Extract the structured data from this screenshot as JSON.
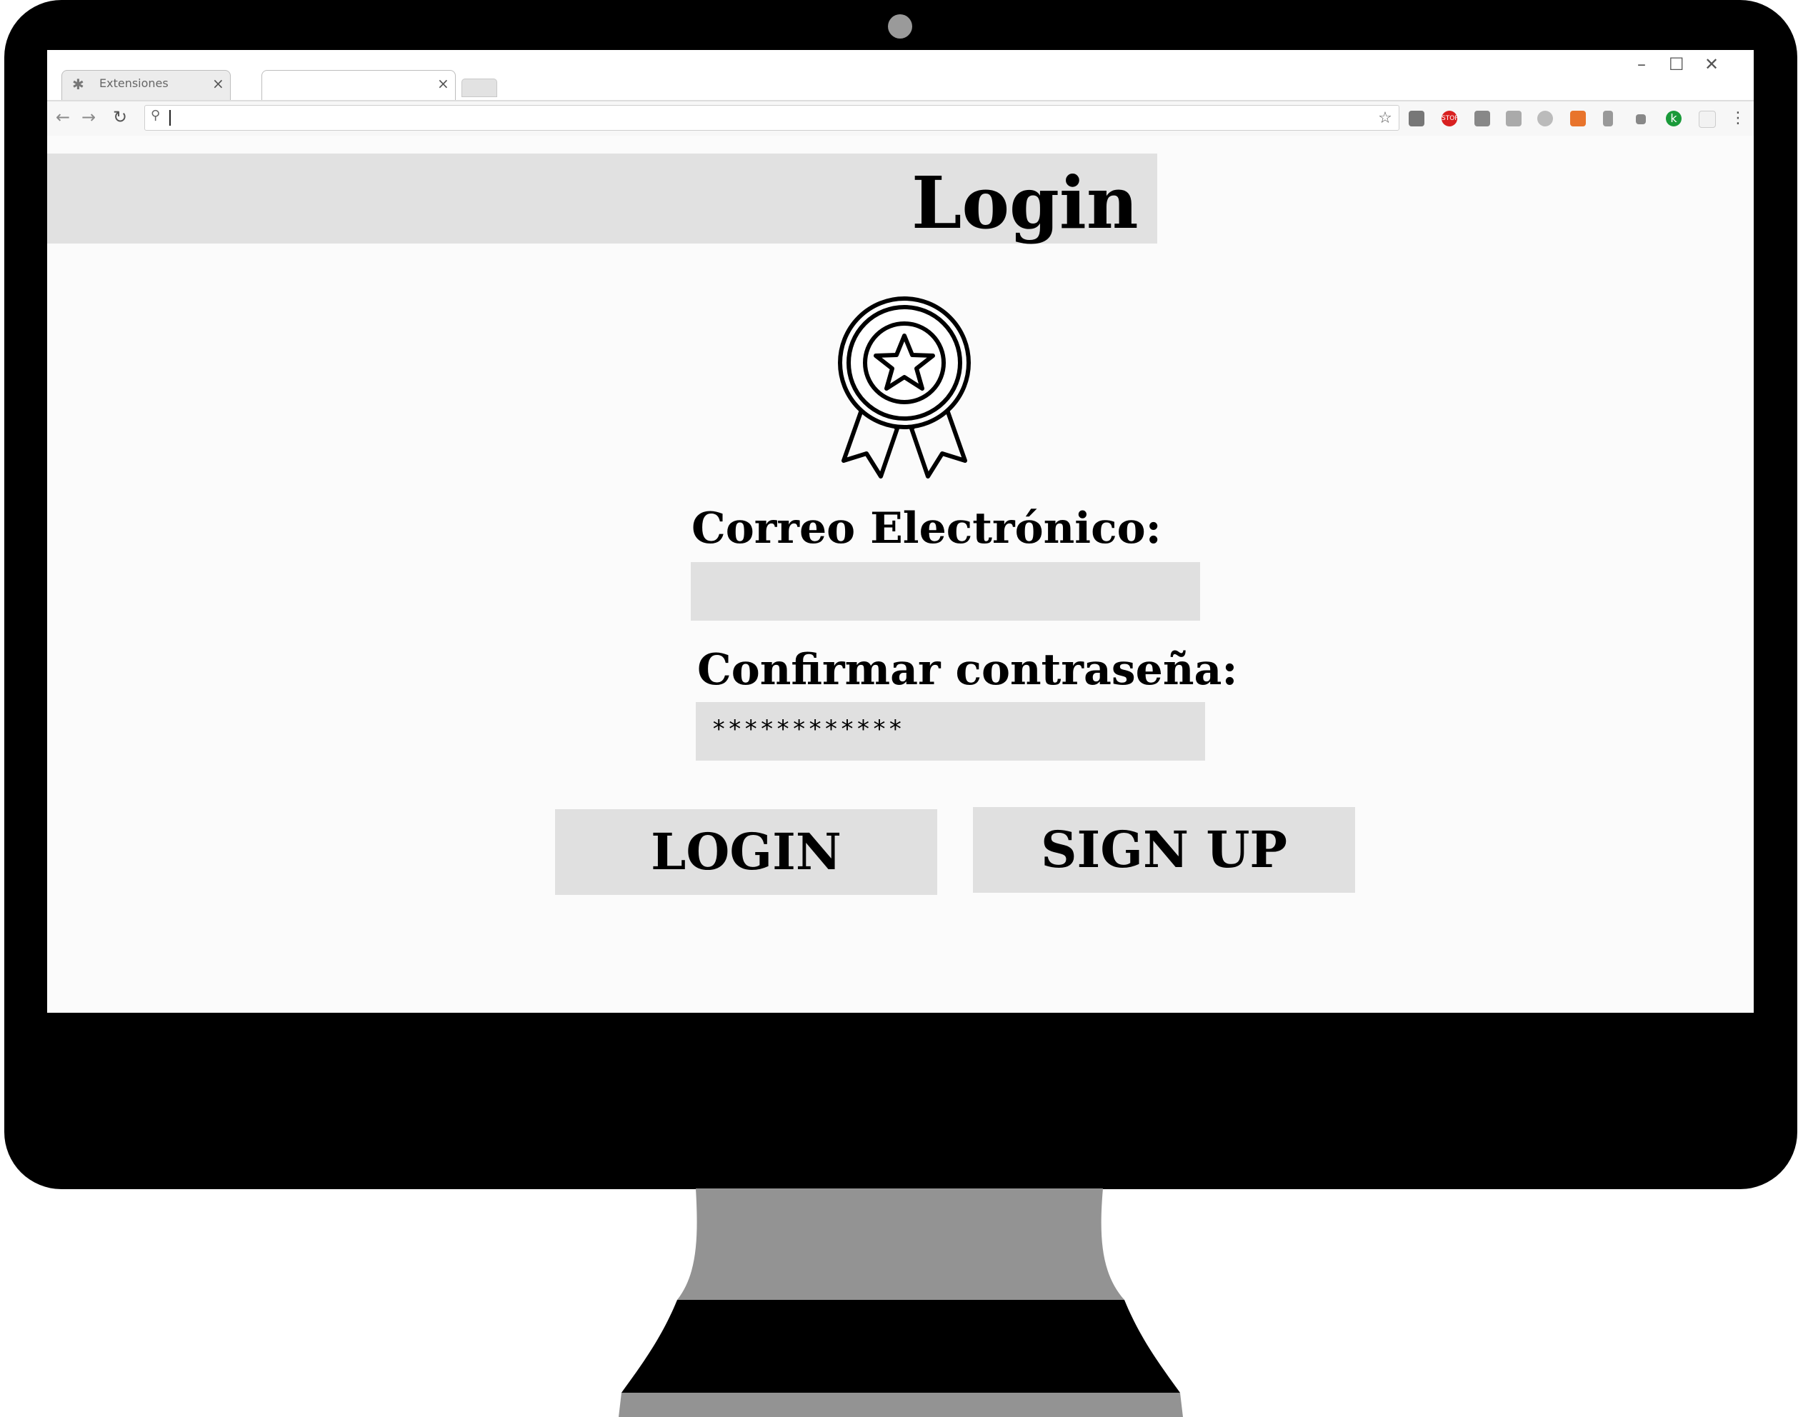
{
  "browser": {
    "tabs": [
      {
        "label": "Extensiones",
        "icon": "puzzle-icon",
        "close": "×"
      },
      {
        "label": "",
        "close": "×"
      }
    ],
    "window_controls": {
      "minimize": "–",
      "maximize": "☐",
      "close": "✕"
    },
    "nav": {
      "back": "←",
      "forward": "→",
      "reload": "↻"
    },
    "omnibox": {
      "value": "",
      "search_icon": "🔍"
    },
    "extensions": [
      "star-icon",
      "extension-icon",
      "stop-icon",
      "extension-icon",
      "extension-icon",
      "extension-icon",
      "extension-icon",
      "extension-icon",
      "extension-icon",
      "green-circle-icon",
      "extension-icon",
      "menu-icon"
    ]
  },
  "page": {
    "title": "Login",
    "badge_icon": "award-ribbon-icon",
    "email": {
      "label": "Correo Electrónico:",
      "value": ""
    },
    "password": {
      "label": "Confirmar contraseña:",
      "value": "************"
    },
    "buttons": {
      "login": "LOGIN",
      "signup": "SIGN UP"
    }
  },
  "colors": {
    "bezel": "#000000",
    "stand": "#939393",
    "field": "#e0e0e0",
    "text": "#000000"
  }
}
